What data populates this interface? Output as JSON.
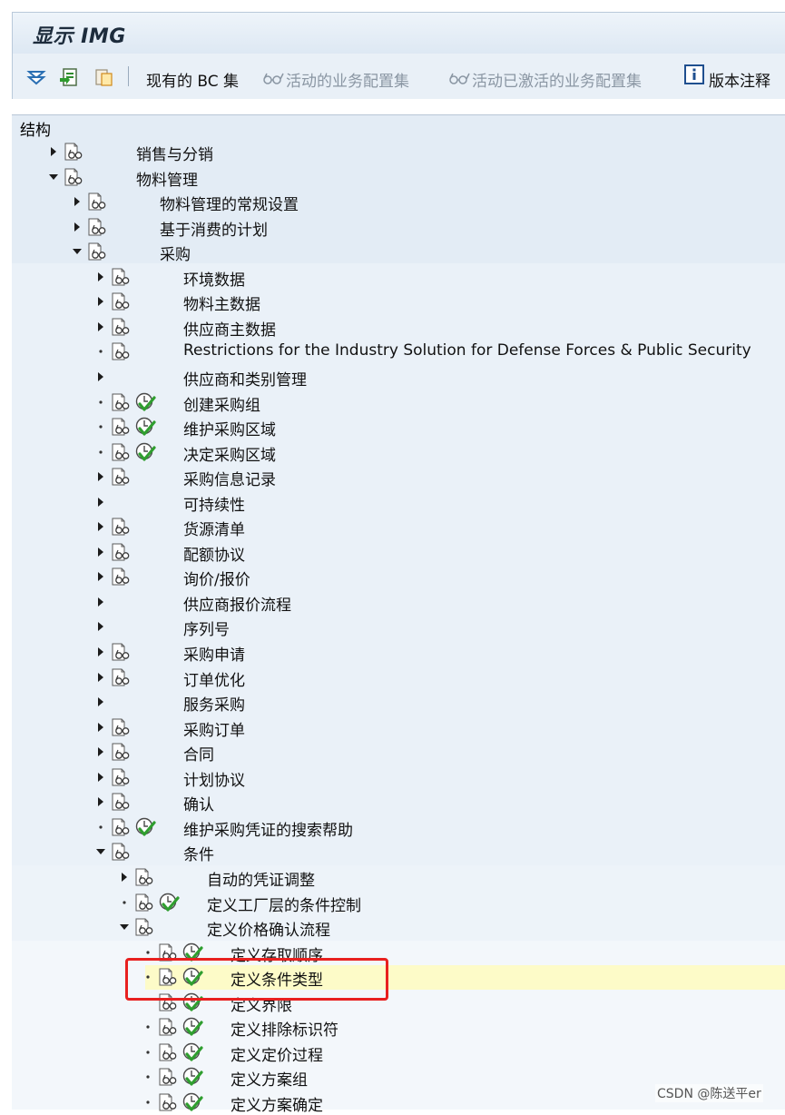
{
  "window": {
    "title": "显示 IMG"
  },
  "toolbar": {
    "icons": [
      "expand-tree-icon",
      "load-icon",
      "clipboard-icon"
    ],
    "current_bc_set": "现有的 BC 集",
    "active_bc_sets": "活动的业务配置集",
    "activated_bc_sets": "活动已激活的业务配置集",
    "release_notes": "版本注释"
  },
  "structure": {
    "header": "结构",
    "rows": [
      {
        "label": "销售与分销",
        "level": 0,
        "expander": "collapsed",
        "doc": true,
        "exec": false
      },
      {
        "label": "物料管理",
        "level": 0,
        "expander": "expanded",
        "doc": true,
        "exec": false
      },
      {
        "label": "物料管理的常规设置",
        "level": 1,
        "expander": "collapsed",
        "doc": true,
        "exec": false
      },
      {
        "label": "基于消费的计划",
        "level": 1,
        "expander": "collapsed",
        "doc": true,
        "exec": false
      },
      {
        "label": "采购",
        "level": 1,
        "expander": "expanded",
        "doc": true,
        "exec": false
      },
      {
        "label": "环境数据",
        "level": 2,
        "expander": "collapsed",
        "doc": true,
        "exec": false
      },
      {
        "label": "物料主数据",
        "level": 2,
        "expander": "collapsed",
        "doc": true,
        "exec": false
      },
      {
        "label": "供应商主数据",
        "level": 2,
        "expander": "collapsed",
        "doc": true,
        "exec": false
      },
      {
        "label": "Restrictions for the Industry Solution for Defense Forces & Public Security",
        "level": 2,
        "expander": "leaf",
        "doc": true,
        "exec": false
      },
      {
        "label": "供应商和类别管理",
        "level": 2,
        "expander": "collapsed",
        "doc": false,
        "exec": false
      },
      {
        "label": "创建采购组",
        "level": 2,
        "expander": "leaf",
        "doc": true,
        "exec": true
      },
      {
        "label": "维护采购区域",
        "level": 2,
        "expander": "leaf",
        "doc": true,
        "exec": true
      },
      {
        "label": "决定采购区域",
        "level": 2,
        "expander": "leaf",
        "doc": true,
        "exec": true
      },
      {
        "label": "采购信息记录",
        "level": 2,
        "expander": "collapsed",
        "doc": true,
        "exec": false
      },
      {
        "label": "可持续性",
        "level": 2,
        "expander": "collapsed",
        "doc": false,
        "exec": false
      },
      {
        "label": "货源清单",
        "level": 2,
        "expander": "collapsed",
        "doc": true,
        "exec": false
      },
      {
        "label": "配额协议",
        "level": 2,
        "expander": "collapsed",
        "doc": true,
        "exec": false
      },
      {
        "label": "询价/报价",
        "level": 2,
        "expander": "collapsed",
        "doc": true,
        "exec": false
      },
      {
        "label": "供应商报价流程",
        "level": 2,
        "expander": "collapsed",
        "doc": false,
        "exec": false
      },
      {
        "label": "序列号",
        "level": 2,
        "expander": "collapsed",
        "doc": false,
        "exec": false
      },
      {
        "label": "采购申请",
        "level": 2,
        "expander": "collapsed",
        "doc": true,
        "exec": false
      },
      {
        "label": "订单优化",
        "level": 2,
        "expander": "collapsed",
        "doc": true,
        "exec": false
      },
      {
        "label": "服务采购",
        "level": 2,
        "expander": "collapsed",
        "doc": false,
        "exec": false
      },
      {
        "label": "采购订单",
        "level": 2,
        "expander": "collapsed",
        "doc": true,
        "exec": false
      },
      {
        "label": "合同",
        "level": 2,
        "expander": "collapsed",
        "doc": true,
        "exec": false
      },
      {
        "label": "计划协议",
        "level": 2,
        "expander": "collapsed",
        "doc": true,
        "exec": false
      },
      {
        "label": "确认",
        "level": 2,
        "expander": "collapsed",
        "doc": true,
        "exec": false
      },
      {
        "label": "维护采购凭证的搜索帮助",
        "level": 2,
        "expander": "leaf",
        "doc": true,
        "exec": true
      },
      {
        "label": "条件",
        "level": 2,
        "expander": "expanded",
        "doc": true,
        "exec": false
      },
      {
        "label": "自动的凭证调整",
        "level": 3,
        "expander": "collapsed",
        "doc": true,
        "exec": false
      },
      {
        "label": "定义工厂层的条件控制",
        "level": 3,
        "expander": "leaf",
        "doc": true,
        "exec": true
      },
      {
        "label": "定义价格确认流程",
        "level": 3,
        "expander": "expanded",
        "doc": true,
        "exec": false
      },
      {
        "label": "定义存取顺序",
        "level": 4,
        "expander": "leaf",
        "doc": true,
        "exec": true
      },
      {
        "label": "定义条件类型",
        "level": 4,
        "expander": "leaf",
        "doc": true,
        "exec": true,
        "selected": true
      },
      {
        "label": "定义界限",
        "level": 4,
        "expander": "none",
        "doc": true,
        "exec": true
      },
      {
        "label": "定义排除标识符",
        "level": 4,
        "expander": "leaf",
        "doc": true,
        "exec": true
      },
      {
        "label": "定义定价过程",
        "level": 4,
        "expander": "leaf",
        "doc": true,
        "exec": true
      },
      {
        "label": "定义方案组",
        "level": 4,
        "expander": "leaf",
        "doc": true,
        "exec": true
      },
      {
        "label": "定义方案确定",
        "level": 4,
        "expander": "leaf",
        "doc": true,
        "exec": true
      }
    ]
  },
  "colors": {
    "band_level0": "#e3ecf5",
    "band_level2": "#eaf1f8",
    "band_level3": "#edf3f9",
    "band_level4": "#f3f7fb",
    "selected_row": "#fdfbc8",
    "annotation_box": "#e8201f"
  },
  "watermark": "CSDN @陈送平er"
}
